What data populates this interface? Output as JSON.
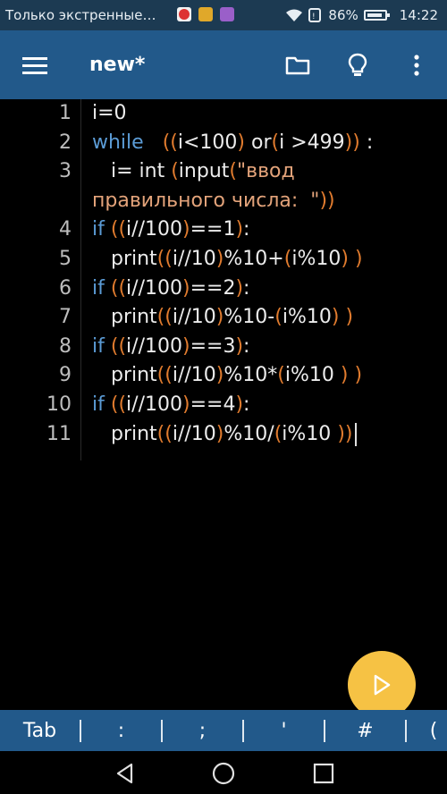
{
  "status_bar": {
    "notification_text": "Только экстренные…",
    "battery_percent": "86%",
    "time": "14:22"
  },
  "app_bar": {
    "title": "new*",
    "icons": [
      "menu-icon",
      "folder-icon",
      "lightbulb-icon",
      "more-vert-icon"
    ]
  },
  "editor": {
    "line_numbers": [
      "1",
      "2",
      "3",
      "",
      "4",
      "5",
      "6",
      "7",
      "8",
      "9",
      "10",
      "11"
    ],
    "lines": [
      {
        "segments": [
          {
            "t": "i=0",
            "c": "plain"
          }
        ]
      },
      {
        "segments": [
          {
            "t": "while",
            "c": "kw"
          },
          {
            "t": "   ",
            "c": "plain"
          },
          {
            "t": "(",
            "c": "par"
          },
          {
            "t": "(",
            "c": "par"
          },
          {
            "t": "i<100",
            "c": "plain"
          },
          {
            "t": ")",
            "c": "par"
          },
          {
            "t": " or",
            "c": "plain"
          },
          {
            "t": "(",
            "c": "par"
          },
          {
            "t": "i >499",
            "c": "plain"
          },
          {
            "t": ")",
            "c": "par"
          },
          {
            "t": ")",
            "c": "par"
          },
          {
            "t": " :",
            "c": "plain"
          }
        ]
      },
      {
        "segments": [
          {
            "t": "   i= int ",
            "c": "plain"
          },
          {
            "t": "(",
            "c": "par"
          },
          {
            "t": "input",
            "c": "plain"
          },
          {
            "t": "(",
            "c": "par"
          },
          {
            "t": "\"ввод",
            "c": "str"
          }
        ]
      },
      {
        "segments": [
          {
            "t": "правильного числа:  \"",
            "c": "str"
          },
          {
            "t": ")",
            "c": "par"
          },
          {
            "t": ")",
            "c": "par"
          }
        ]
      },
      {
        "segments": [
          {
            "t": "if",
            "c": "kw"
          },
          {
            "t": " ",
            "c": "plain"
          },
          {
            "t": "(",
            "c": "par"
          },
          {
            "t": "(",
            "c": "par"
          },
          {
            "t": "i//100",
            "c": "plain"
          },
          {
            "t": ")",
            "c": "par"
          },
          {
            "t": "==1",
            "c": "plain"
          },
          {
            "t": ")",
            "c": "par"
          },
          {
            "t": ":",
            "c": "plain"
          }
        ]
      },
      {
        "segments": [
          {
            "t": "   print",
            "c": "plain"
          },
          {
            "t": "(",
            "c": "par"
          },
          {
            "t": "(",
            "c": "par"
          },
          {
            "t": "i//10",
            "c": "plain"
          },
          {
            "t": ")",
            "c": "par"
          },
          {
            "t": "%10+",
            "c": "plain"
          },
          {
            "t": "(",
            "c": "par"
          },
          {
            "t": "i%10",
            "c": "plain"
          },
          {
            "t": ")",
            "c": "par"
          },
          {
            "t": " ",
            "c": "plain"
          },
          {
            "t": ")",
            "c": "par"
          }
        ]
      },
      {
        "segments": [
          {
            "t": "if",
            "c": "kw"
          },
          {
            "t": " ",
            "c": "plain"
          },
          {
            "t": "(",
            "c": "par"
          },
          {
            "t": "(",
            "c": "par"
          },
          {
            "t": "i//100",
            "c": "plain"
          },
          {
            "t": ")",
            "c": "par"
          },
          {
            "t": "==2",
            "c": "plain"
          },
          {
            "t": ")",
            "c": "par"
          },
          {
            "t": ":",
            "c": "plain"
          }
        ]
      },
      {
        "segments": [
          {
            "t": "   print",
            "c": "plain"
          },
          {
            "t": "(",
            "c": "par"
          },
          {
            "t": "(",
            "c": "par"
          },
          {
            "t": "i//10",
            "c": "plain"
          },
          {
            "t": ")",
            "c": "par"
          },
          {
            "t": "%10-",
            "c": "plain"
          },
          {
            "t": "(",
            "c": "par"
          },
          {
            "t": "i%10",
            "c": "plain"
          },
          {
            "t": ")",
            "c": "par"
          },
          {
            "t": " ",
            "c": "plain"
          },
          {
            "t": ")",
            "c": "par"
          }
        ]
      },
      {
        "segments": [
          {
            "t": "if",
            "c": "kw"
          },
          {
            "t": " ",
            "c": "plain"
          },
          {
            "t": "(",
            "c": "par"
          },
          {
            "t": "(",
            "c": "par"
          },
          {
            "t": "i//100",
            "c": "plain"
          },
          {
            "t": ")",
            "c": "par"
          },
          {
            "t": "==3",
            "c": "plain"
          },
          {
            "t": ")",
            "c": "par"
          },
          {
            "t": ":",
            "c": "plain"
          }
        ]
      },
      {
        "segments": [
          {
            "t": "   print",
            "c": "plain"
          },
          {
            "t": "(",
            "c": "par"
          },
          {
            "t": "(",
            "c": "par"
          },
          {
            "t": "i//10",
            "c": "plain"
          },
          {
            "t": ")",
            "c": "par"
          },
          {
            "t": "%10*",
            "c": "plain"
          },
          {
            "t": "(",
            "c": "par"
          },
          {
            "t": "i%10 ",
            "c": "plain"
          },
          {
            "t": ")",
            "c": "par"
          },
          {
            "t": " ",
            "c": "plain"
          },
          {
            "t": ")",
            "c": "par"
          }
        ]
      },
      {
        "segments": [
          {
            "t": "if",
            "c": "kw"
          },
          {
            "t": " ",
            "c": "plain"
          },
          {
            "t": "(",
            "c": "par"
          },
          {
            "t": "(",
            "c": "par"
          },
          {
            "t": "i//100",
            "c": "plain"
          },
          {
            "t": ")",
            "c": "par"
          },
          {
            "t": "==4",
            "c": "plain"
          },
          {
            "t": ")",
            "c": "par"
          },
          {
            "t": ":",
            "c": "plain"
          }
        ]
      },
      {
        "segments": [
          {
            "t": "   print",
            "c": "plain"
          },
          {
            "t": "(",
            "c": "par"
          },
          {
            "t": "(",
            "c": "par"
          },
          {
            "t": "i//10",
            "c": "plain"
          },
          {
            "t": ")",
            "c": "par"
          },
          {
            "t": "%10/",
            "c": "plain"
          },
          {
            "t": "(",
            "c": "par"
          },
          {
            "t": "i%10 ",
            "c": "plain"
          },
          {
            "t": ")",
            "c": "par"
          },
          {
            "t": ")",
            "c": "par"
          }
        ]
      }
    ]
  },
  "run_button": {
    "icon": "play-icon"
  },
  "key_bar": {
    "keys": [
      "Tab",
      ":",
      ";",
      "'",
      "#",
      "("
    ]
  },
  "nav_bar": {
    "icons": [
      "back-icon",
      "home-icon",
      "recents-icon"
    ]
  },
  "colors": {
    "status_bar": "#1c3a52",
    "app_bar": "#22598a",
    "keyword": "#5b9bd5",
    "paren": "#e07b2e",
    "string": "#e3a37a",
    "fab": "#f6c244"
  }
}
